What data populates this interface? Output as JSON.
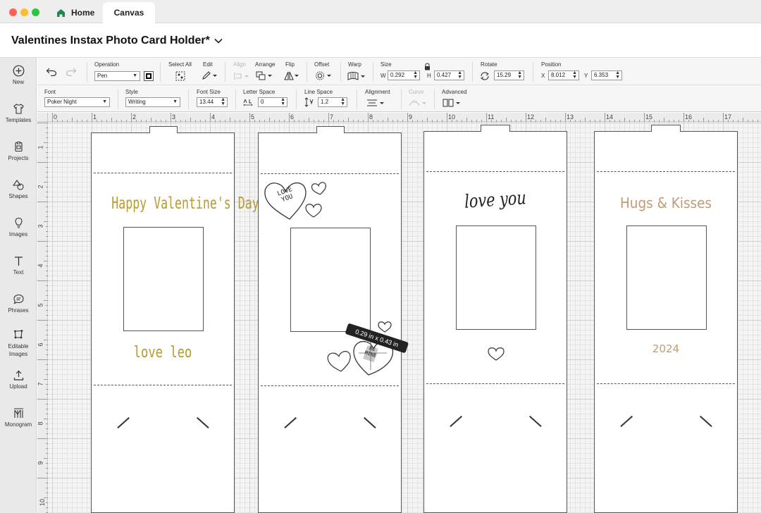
{
  "window": {
    "tabs": [
      {
        "label": "Home",
        "icon": "home-icon"
      },
      {
        "label": "Canvas"
      }
    ]
  },
  "project": {
    "title": "Valentines Instax Photo Card Holder*"
  },
  "sidebar": {
    "items": [
      {
        "label": "New",
        "icon": "plus-circle-icon"
      },
      {
        "label": "Templates",
        "icon": "shirt-icon"
      },
      {
        "label": "Projects",
        "icon": "projects-icon"
      },
      {
        "label": "Shapes",
        "icon": "shapes-icon"
      },
      {
        "label": "Images",
        "icon": "lightbulb-icon"
      },
      {
        "label": "Text",
        "icon": "text-icon"
      },
      {
        "label": "Phrases",
        "icon": "speech-bubble-icon"
      },
      {
        "label": "Editable Images",
        "icon": "editable-images-icon"
      },
      {
        "label": "Upload",
        "icon": "upload-icon"
      },
      {
        "label": "Monogram",
        "icon": "monogram-icon"
      }
    ]
  },
  "toolbar": {
    "operation": {
      "label": "Operation",
      "value": "Pen"
    },
    "select_all": {
      "label": "Select All"
    },
    "edit": {
      "label": "Edit"
    },
    "align": {
      "label": "Align"
    },
    "arrange": {
      "label": "Arrange"
    },
    "flip": {
      "label": "Flip"
    },
    "offset": {
      "label": "Offset"
    },
    "warp": {
      "label": "Warp"
    },
    "size": {
      "label": "Size",
      "w_label": "W",
      "w": "0.292",
      "h_label": "H",
      "h": "0.427"
    },
    "rotate": {
      "label": "Rotate",
      "value": "15.29"
    },
    "position": {
      "label": "Position",
      "x_label": "X",
      "x": "8.012",
      "y_label": "Y",
      "y": "6.353"
    }
  },
  "text_toolbar": {
    "font": {
      "label": "Font",
      "value": "Poker Night"
    },
    "style": {
      "label": "Style",
      "value": "Writing"
    },
    "font_size": {
      "label": "Font Size",
      "value": "13.44"
    },
    "letter_space": {
      "label": "Letter Space",
      "value": "0"
    },
    "line_space": {
      "label": "Line Space",
      "value": "1.2"
    },
    "alignment": {
      "label": "Alignment"
    },
    "curve": {
      "label": "Curve"
    },
    "advanced": {
      "label": "Advanced"
    }
  },
  "ruler": {
    "top": [
      "0",
      "1",
      "2",
      "3",
      "4",
      "5",
      "6",
      "7",
      "8",
      "9",
      "10",
      "11",
      "12",
      "13",
      "14",
      "15",
      "16",
      "17"
    ],
    "left": [
      "1",
      "2",
      "3",
      "4",
      "5",
      "6",
      "7",
      "8",
      "9",
      "10"
    ]
  },
  "cards": [
    {
      "top_text": "Happy Valentine's Day",
      "bottom_text": "love leo"
    },
    {
      "heart_text_line1": "LOVE",
      "heart_text_line2": "YOU",
      "small_heart_text_line1": "BE",
      "small_heart_text_line2": "MINE"
    },
    {
      "top_text": "love you"
    },
    {
      "top_text": "Hugs & Kisses",
      "bottom_text": "2024"
    }
  ],
  "selection": {
    "dimension_text": "0.29  in x 0.43  in"
  },
  "colors": {
    "gold": "#b79a32",
    "tan": "#c49a72",
    "accent_green": "#1d8a4a"
  }
}
